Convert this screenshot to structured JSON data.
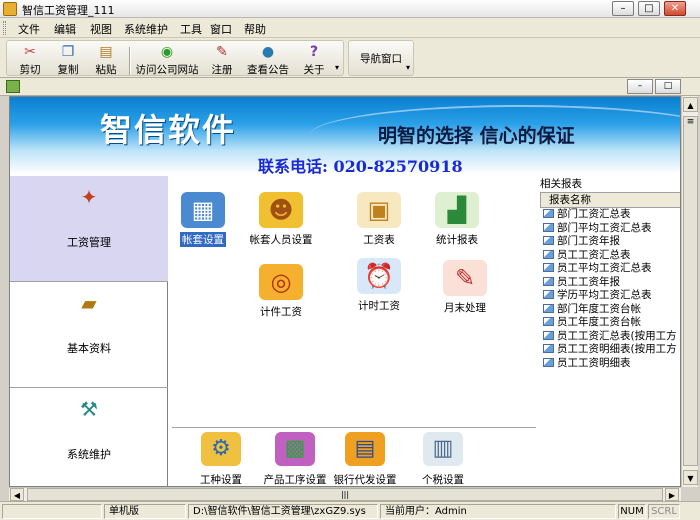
{
  "window": {
    "title": "智信工资管理_111",
    "min": "–",
    "max": "□",
    "close": "✕"
  },
  "menu": [
    "文件",
    "编辑",
    "视图",
    "系统维护",
    "工具",
    "窗口",
    "帮助"
  ],
  "toolbar": {
    "cut": "剪切",
    "copy": "复制",
    "paste": "粘贴",
    "visit_site": "访问公司网站",
    "register": "注册",
    "announcements": "查看公告",
    "about": "关于",
    "nav_window": "导航窗口"
  },
  "banner": {
    "brand": "智信软件",
    "slogan": "明智的选择 信心的保证",
    "contact": "联系电话: 020-82570918"
  },
  "left_nav": [
    "工资管理",
    "基本资料",
    "系统维护"
  ],
  "features": {
    "account_setup": "帐套设置",
    "account_staff_setup": "帐套人员设置",
    "payroll_table": "工资表",
    "stat_report": "统计报表",
    "piece_wage": "计件工资",
    "hourly_wage": "计时工资",
    "month_end": "月末处理"
  },
  "bottom_features": {
    "job_type": "工种设置",
    "product_process": "产品工序设置",
    "bank_payroll": "银行代发设置",
    "income_tax": "个税设置"
  },
  "reports": {
    "title": "相关报表",
    "header": "报表名称",
    "items": [
      "部门工资汇总表",
      "部门平均工资汇总表",
      "部门工资年报",
      "员工工资汇总表",
      "员工平均工资汇总表",
      "员工工资年报",
      "学历平均工资汇总表",
      "部门年度工资台帐",
      "员工年度工资台帐",
      "员工工资汇总表(按用工方",
      "员工工资明细表(按用工方",
      "员工工资明细表"
    ]
  },
  "scroll": {
    "grip_v": "≡",
    "grip_h": "|||"
  },
  "status": {
    "edition": "单机版",
    "path": "D:\\智信软件\\智信工资管理\\zxGZ9.sys",
    "user": "当前用户：Admin",
    "num": "NUM",
    "scrl": "SCRL"
  }
}
